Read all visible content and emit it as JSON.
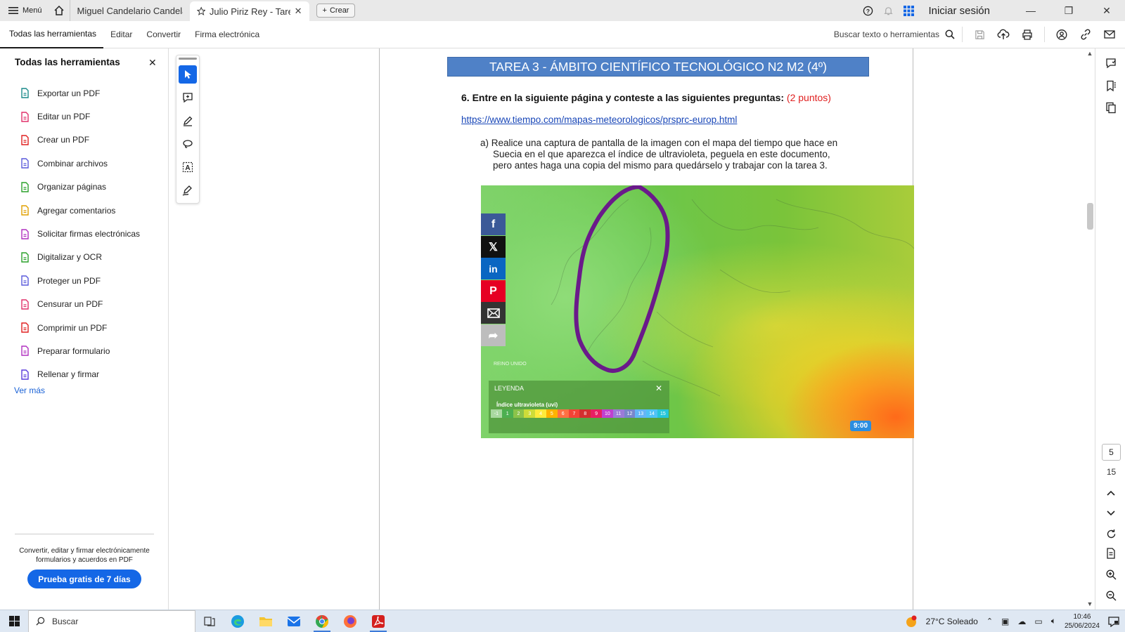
{
  "tabbar": {
    "menu_label": "Menú",
    "tabs": [
      {
        "label": "Miguel Candelario Candela..."
      },
      {
        "label": "Julio Piriz Rey - Tare..."
      }
    ],
    "create_label": "Crear",
    "signin_label": "Iniciar sesión"
  },
  "toolbar": {
    "items": [
      {
        "label": "Todas las herramientas"
      },
      {
        "label": "Editar"
      },
      {
        "label": "Convertir"
      },
      {
        "label": "Firma electrónica"
      }
    ],
    "search_label": "Buscar texto o herramientas"
  },
  "leftpanel": {
    "title": "Todas las herramientas",
    "tools": [
      {
        "label": "Exportar un PDF",
        "icon": "export-pdf-icon",
        "color": "#1a8a8a"
      },
      {
        "label": "Editar un PDF",
        "icon": "edit-pdf-icon",
        "color": "#e0306a"
      },
      {
        "label": "Crear un PDF",
        "icon": "create-pdf-icon",
        "color": "#e02020"
      },
      {
        "label": "Combinar archivos",
        "icon": "combine-files-icon",
        "color": "#5a5adc"
      },
      {
        "label": "Organizar páginas",
        "icon": "organize-pages-icon",
        "color": "#2aa02a"
      },
      {
        "label": "Agregar comentarios",
        "icon": "comment-icon",
        "color": "#e0a000"
      },
      {
        "label": "Solicitar firmas electrónicas",
        "icon": "request-signature-icon",
        "color": "#b030c0"
      },
      {
        "label": "Digitalizar y OCR",
        "icon": "scan-ocr-icon",
        "color": "#2aa02a"
      },
      {
        "label": "Proteger un PDF",
        "icon": "protect-pdf-icon",
        "color": "#5a5adc"
      },
      {
        "label": "Censurar un PDF",
        "icon": "redact-pdf-icon",
        "color": "#e0306a"
      },
      {
        "label": "Comprimir un PDF",
        "icon": "compress-pdf-icon",
        "color": "#e02020"
      },
      {
        "label": "Preparar formulario",
        "icon": "prepare-form-icon",
        "color": "#b030c0"
      },
      {
        "label": "Rellenar y firmar",
        "icon": "fill-sign-icon",
        "color": "#5a3adc"
      }
    ],
    "more_label": "Ver más",
    "promo_text": "Convertir, editar y firmar electrónicamente formularios y acuerdos en PDF",
    "trial_label": "Prueba gratis de 7 días"
  },
  "document": {
    "banner": "TAREA 3  - ÁMBITO CIENTÍFICO TECNOLÓGICO N2 M2 (4º)",
    "question": "6. Entre en la siguiente página y conteste a las siguientes preguntas:",
    "points": "(2 puntos)",
    "link": "https://www.tiempo.com/mapas-meteorologicos/prsprc-europ.html",
    "sub_a_line1": "a) Realice una captura de pantalla de la imagen con el mapa del tiempo que hace en",
    "sub_a_line2": "Suecia en el que aparezca el índice de ultravioleta, peguela en este documento,",
    "sub_a_line3": "pero antes haga una copia del mismo para quedárselo y trabajar con la tarea 3.",
    "map": {
      "legend_title": "LEYENDA",
      "legend_subtitle": "Índice ultravioleta (uvi)",
      "scale": [
        {
          "v": "-1",
          "c": "#a9d9a0"
        },
        {
          "v": "1",
          "c": "#4caf50"
        },
        {
          "v": "2",
          "c": "#8bc34a"
        },
        {
          "v": "3",
          "c": "#cddc39"
        },
        {
          "v": "4",
          "c": "#ffeb3b"
        },
        {
          "v": "5",
          "c": "#ffb300"
        },
        {
          "v": "6",
          "c": "#ff7043"
        },
        {
          "v": "7",
          "c": "#f44336"
        },
        {
          "v": "8",
          "c": "#d32f2f"
        },
        {
          "v": "9",
          "c": "#e91e63"
        },
        {
          "v": "10",
          "c": "#c040d0"
        },
        {
          "v": "11",
          "c": "#9c7bd9"
        },
        {
          "v": "12",
          "c": "#7986cb"
        },
        {
          "v": "13",
          "c": "#64b5f6"
        },
        {
          "v": "14",
          "c": "#4fc3f7"
        },
        {
          "v": "15",
          "c": "#26c6da"
        }
      ],
      "time": "9:00",
      "label_uk": "REINO UNIDO"
    }
  },
  "pager": {
    "current": "5",
    "total": "15"
  },
  "taskbar": {
    "search_placeholder": "Buscar",
    "weather": "27°C  Soleado",
    "time": "10:46",
    "date": "25/06/2024"
  }
}
